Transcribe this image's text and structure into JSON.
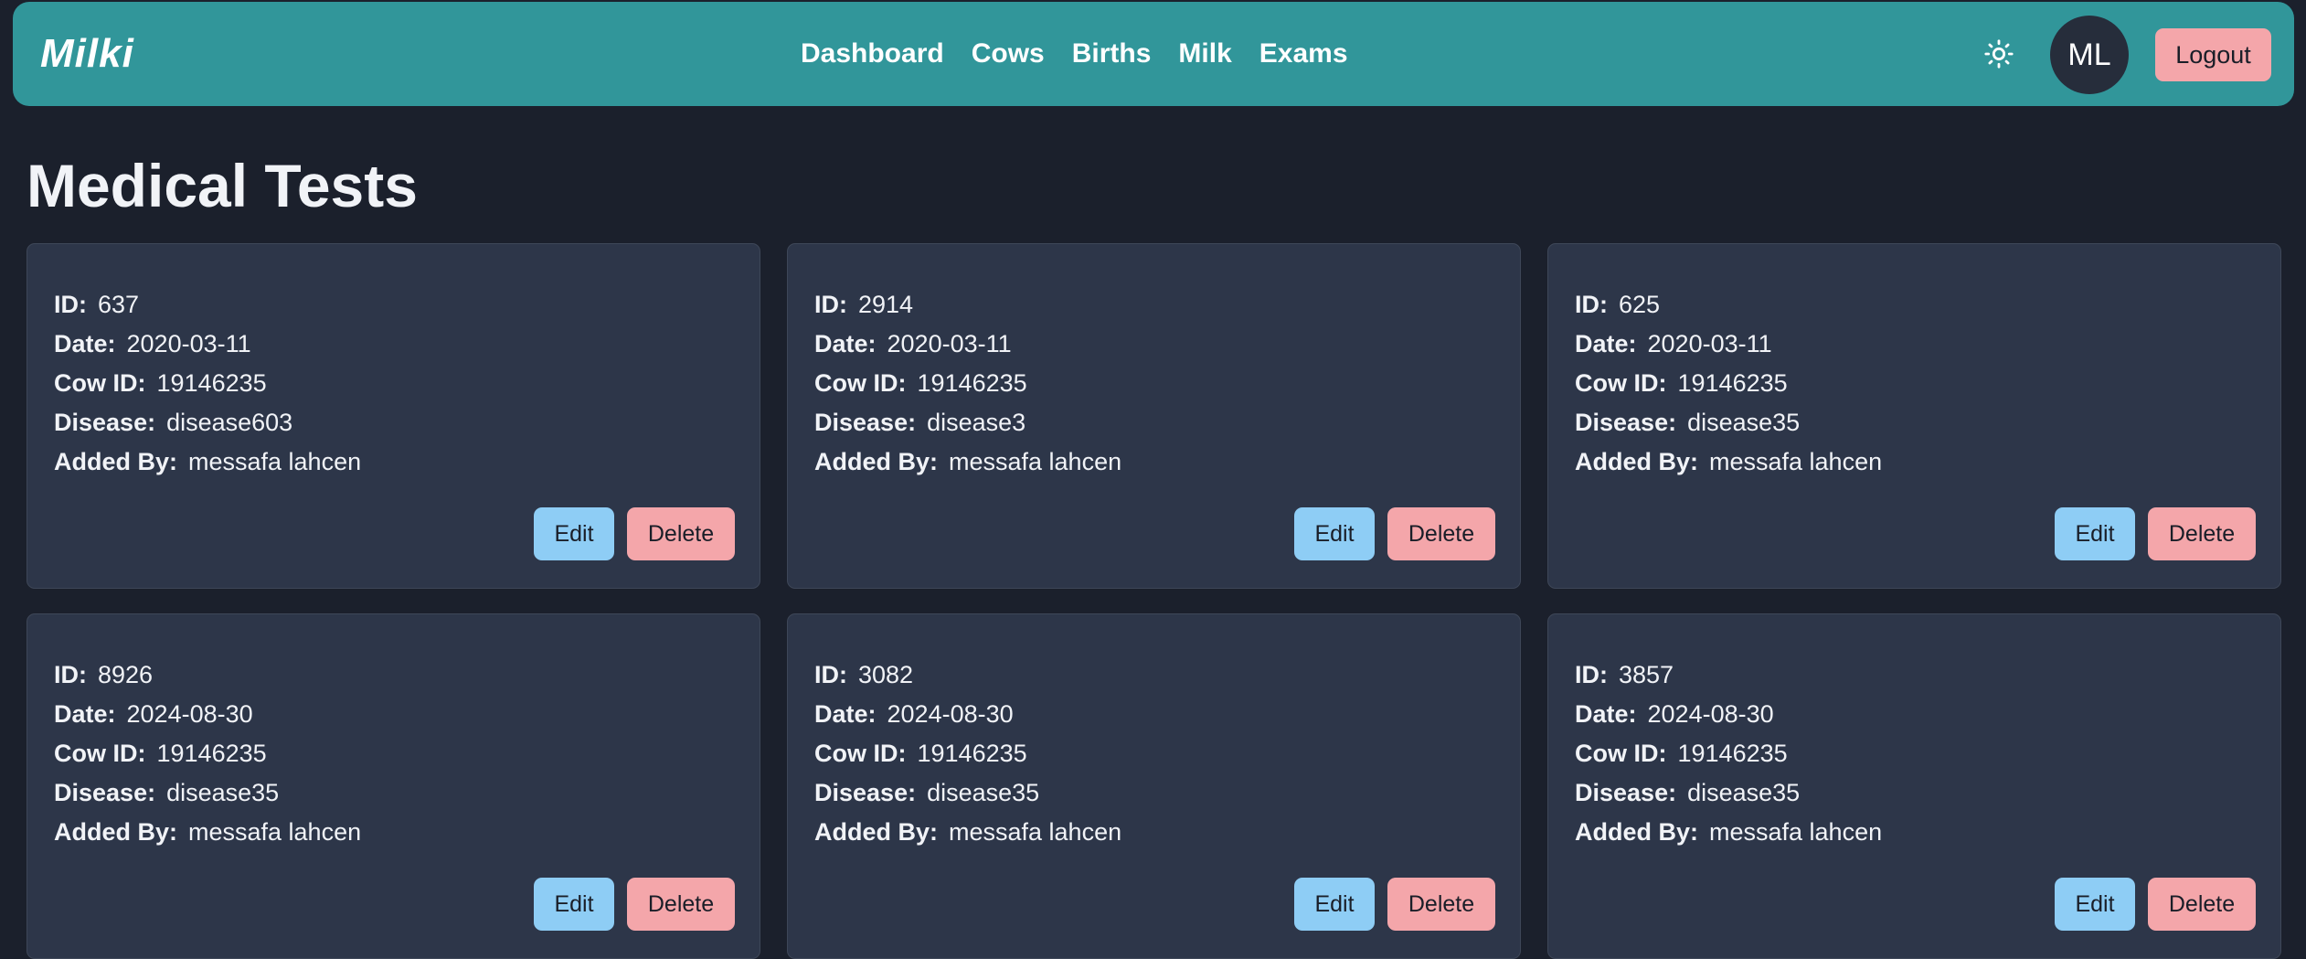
{
  "navbar": {
    "brand": "Milki",
    "links": [
      "Dashboard",
      "Cows",
      "Births",
      "Milk",
      "Exams"
    ],
    "theme_icon": "sun-icon",
    "avatar_initials": "ML",
    "logout_label": "Logout",
    "colors": {
      "bar": "#31969a",
      "avatar_bg": "#262d3b",
      "logout_bg": "#f4a6aa"
    }
  },
  "page": {
    "title": "Medical Tests",
    "background": "#1b202c"
  },
  "labels": {
    "id": "ID:",
    "date": "Date:",
    "cow_id": "Cow ID:",
    "disease": "Disease:",
    "added_by": "Added By:",
    "edit": "Edit",
    "delete": "Delete"
  },
  "tests": [
    {
      "id": "637",
      "date": "2020-03-11",
      "cow_id": "19146235",
      "disease": "disease603",
      "added_by": "messafa lahcen"
    },
    {
      "id": "2914",
      "date": "2020-03-11",
      "cow_id": "19146235",
      "disease": "disease3",
      "added_by": "messafa lahcen"
    },
    {
      "id": "625",
      "date": "2020-03-11",
      "cow_id": "19146235",
      "disease": "disease35",
      "added_by": "messafa lahcen"
    },
    {
      "id": "8926",
      "date": "2024-08-30",
      "cow_id": "19146235",
      "disease": "disease35",
      "added_by": "messafa lahcen"
    },
    {
      "id": "3082",
      "date": "2024-08-30",
      "cow_id": "19146235",
      "disease": "disease35",
      "added_by": "messafa lahcen"
    },
    {
      "id": "3857",
      "date": "2024-08-30",
      "cow_id": "19146235",
      "disease": "disease35",
      "added_by": "messafa lahcen"
    }
  ],
  "colors": {
    "card_bg": "#2d3649",
    "edit_button": "#8ecdf5",
    "delete_button": "#f4a6aa"
  }
}
